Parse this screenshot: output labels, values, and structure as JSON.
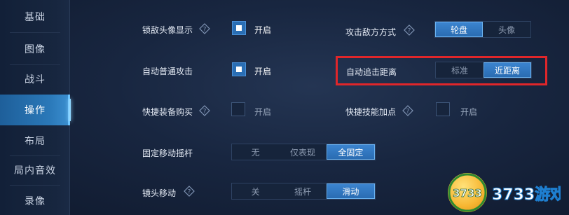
{
  "sidebar": {
    "items": [
      {
        "label": "基础"
      },
      {
        "label": "图像"
      },
      {
        "label": "战斗"
      },
      {
        "label": "操作"
      },
      {
        "label": "布局"
      },
      {
        "label": "局内音效"
      },
      {
        "label": "录像"
      }
    ],
    "active_index": 3
  },
  "settings": {
    "lock_enemy_avatar": {
      "label": "锁敌头像显示",
      "toggle_label": "开启",
      "checked": true
    },
    "attack_enemy_mode": {
      "label": "攻击敌方方式",
      "options": [
        "轮盘",
        "头像"
      ],
      "selected": "轮盘"
    },
    "auto_normal_attack": {
      "label": "自动普通攻击",
      "toggle_label": "开启",
      "checked": true
    },
    "auto_chase_distance": {
      "label": "自动追击距离",
      "options": [
        "标准",
        "近距离"
      ],
      "selected": "近距离"
    },
    "quick_equip_buy": {
      "label": "快捷装备购买",
      "toggle_label": "开启",
      "checked": false
    },
    "quick_skill_upgrade": {
      "label": "快捷技能加点",
      "toggle_label": "开启",
      "checked": false
    },
    "fixed_joystick": {
      "label": "固定移动摇杆",
      "options": [
        "无",
        "仅表现",
        "全固定"
      ],
      "selected": "全固定"
    },
    "camera_move": {
      "label": "镜头移动",
      "options": [
        "关",
        "摇杆",
        "滑动"
      ],
      "selected": "滑动"
    }
  },
  "watermark": {
    "badge_text": "3733",
    "site_text": "3733游戏"
  },
  "colors": {
    "accent": "#2a6eb4",
    "highlight_border": "#e0262a",
    "background": "#182640"
  },
  "icons": {
    "help": "question-diamond-icon"
  }
}
